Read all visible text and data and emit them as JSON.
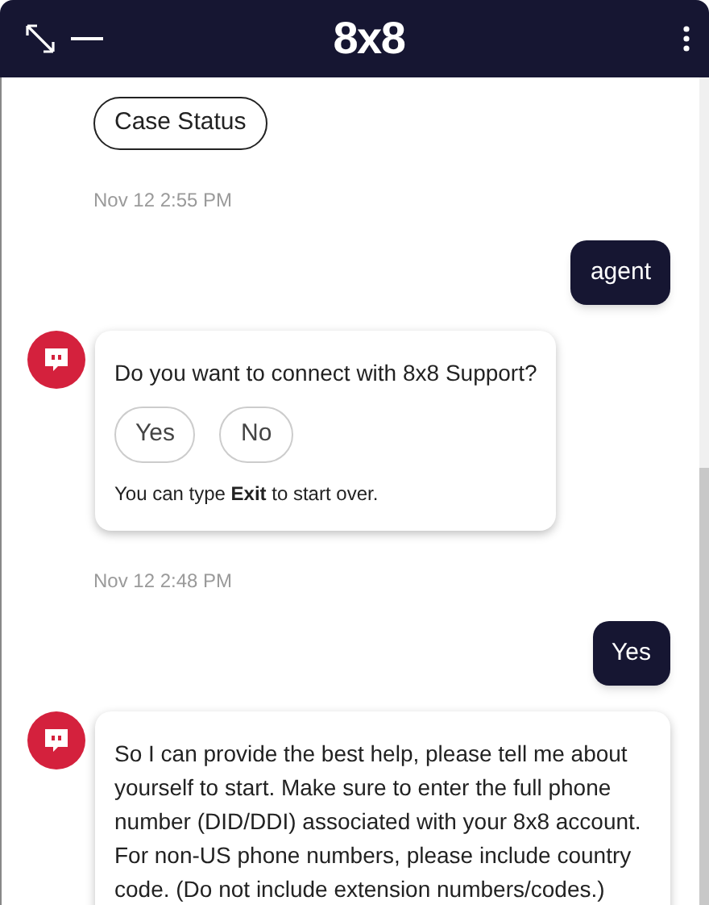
{
  "header": {
    "logo": "8x8"
  },
  "messages": [
    {
      "kind": "buttons",
      "buttons": [
        "Case Status"
      ]
    },
    {
      "kind": "timestamp",
      "text": "Nov 12 2:55 PM"
    },
    {
      "kind": "user",
      "text": "agent"
    },
    {
      "kind": "bot",
      "text": "Do you want to connect with 8x8 Support?",
      "buttons": [
        "Yes",
        "No"
      ],
      "note": "You can type **Exit** to start over."
    },
    {
      "kind": "timestamp",
      "text": "Nov 12 2:48 PM"
    },
    {
      "kind": "user",
      "text": "Yes"
    },
    {
      "kind": "bot",
      "text": "So I can provide the best help, please tell me about yourself to start. Make sure to enter the full phone number (DID/DDI) associated with your 8x8 account. For non-US phone numbers, please include country code. (Do not include extension numbers/codes.)"
    }
  ]
}
